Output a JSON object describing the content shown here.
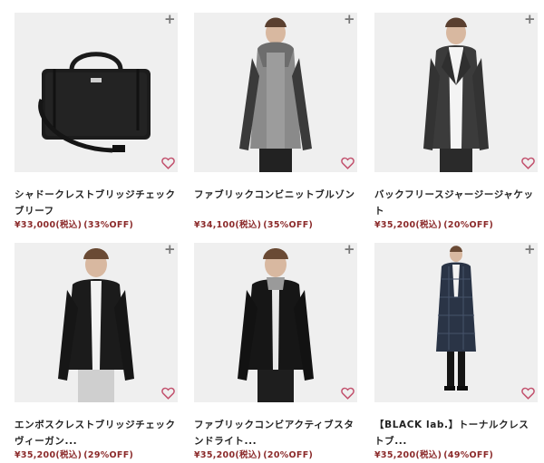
{
  "colors": {
    "price": "#8b2a2a",
    "heart": "#c2516d",
    "photo_bg": "#efefef",
    "plus": "#777777"
  },
  "icons": {
    "add": "plus-icon",
    "favorite": "heart-outline-icon"
  },
  "products": [
    {
      "image": "black-briefcase-bag",
      "title": "シャドークレストブリッジチェックブリーフ",
      "price": "¥33,000(税込)",
      "discount": "(33%OFF)",
      "plus": "+"
    },
    {
      "image": "model-grey-check-hooded-blouson",
      "title": "ファブリックコンビニットブルゾン",
      "price": "¥34,100(税込)",
      "discount": "(35%OFF)",
      "plus": "+"
    },
    {
      "image": "model-charcoal-jersey-jacket",
      "title": "バックフリースジャージージャケット",
      "price": "¥35,200(税込)",
      "discount": "(20%OFF)",
      "plus": "+"
    },
    {
      "image": "model-black-leather-jacket",
      "title": "エンボスクレストブリッジチェックヴィーガン...",
      "price": "¥35,200(税込)",
      "discount": "(29%OFF)",
      "plus": "+"
    },
    {
      "image": "model-black-stand-collar-jacket",
      "title": "ファブリックコンビアクティブスタンドライト...",
      "price": "¥35,200(税込)",
      "discount": "(20%OFF)",
      "plus": "+"
    },
    {
      "image": "model-navy-check-long-coat",
      "title": "【BLACK lab.】トーナルクレストブ...",
      "price": "¥35,200(税込)",
      "discount": "(49%OFF)",
      "plus": "+"
    }
  ]
}
